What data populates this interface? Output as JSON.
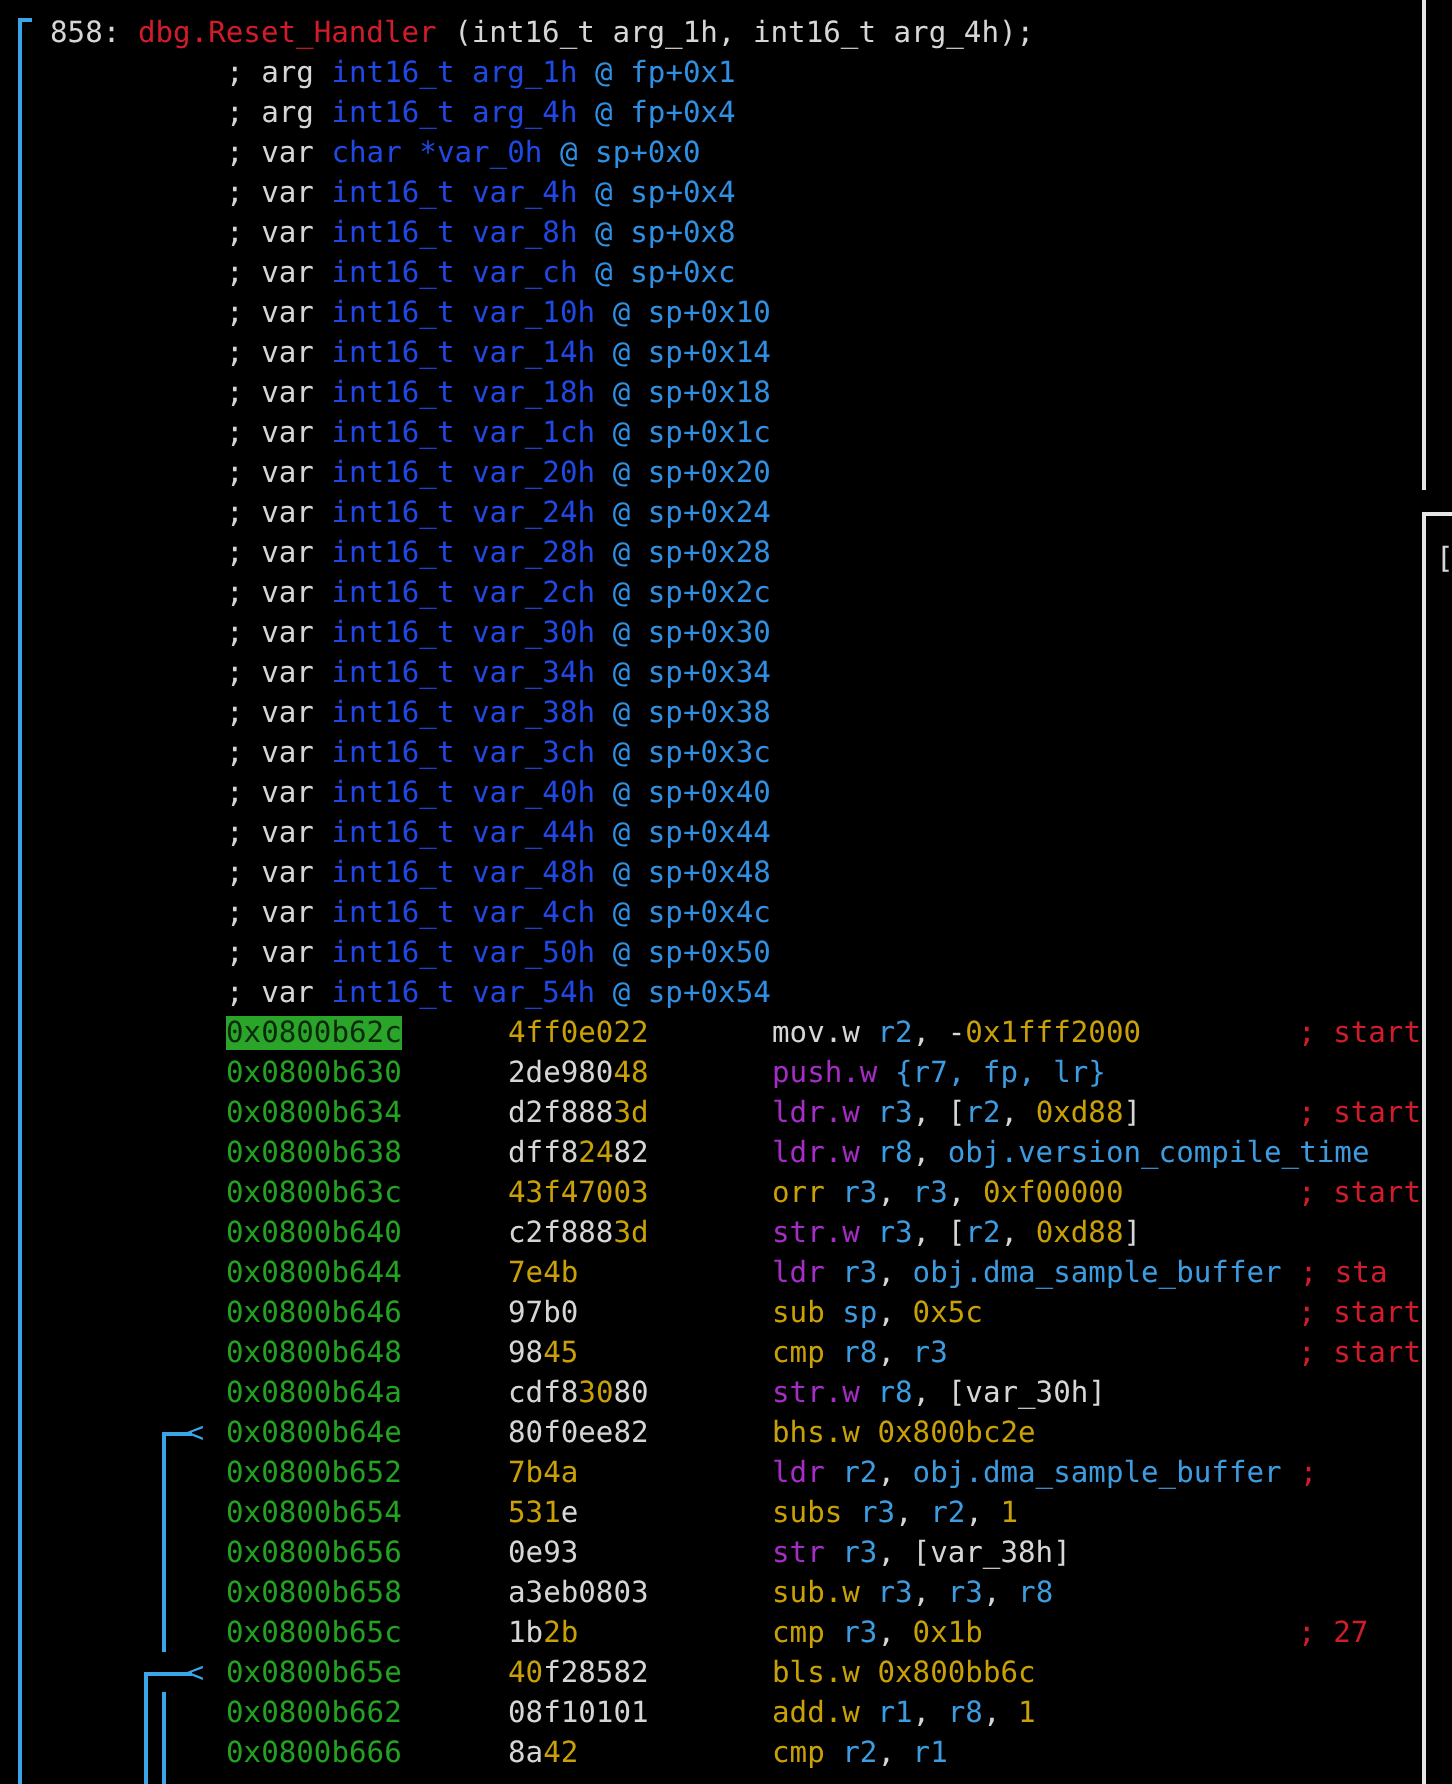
{
  "function": {
    "number": "858:",
    "name": "dbg.Reset_Handler",
    "signature": " (int16_t arg_1h, int16_t arg_4h);"
  },
  "variables": [
    {
      "marker": "; arg",
      "declaration": "int16_t arg_1h",
      "location": "@ fp+0x1"
    },
    {
      "marker": "; arg",
      "declaration": "int16_t arg_4h",
      "location": "@ fp+0x4"
    },
    {
      "marker": "; var",
      "declaration": "char *var_0h",
      "location": "@ sp+0x0"
    },
    {
      "marker": "; var",
      "declaration": "int16_t var_4h",
      "location": "@ sp+0x4"
    },
    {
      "marker": "; var",
      "declaration": "int16_t var_8h",
      "location": "@ sp+0x8"
    },
    {
      "marker": "; var",
      "declaration": "int16_t var_ch",
      "location": "@ sp+0xc"
    },
    {
      "marker": "; var",
      "declaration": "int16_t var_10h",
      "location": "@ sp+0x10"
    },
    {
      "marker": "; var",
      "declaration": "int16_t var_14h",
      "location": "@ sp+0x14"
    },
    {
      "marker": "; var",
      "declaration": "int16_t var_18h",
      "location": "@ sp+0x18"
    },
    {
      "marker": "; var",
      "declaration": "int16_t var_1ch",
      "location": "@ sp+0x1c"
    },
    {
      "marker": "; var",
      "declaration": "int16_t var_20h",
      "location": "@ sp+0x20"
    },
    {
      "marker": "; var",
      "declaration": "int16_t var_24h",
      "location": "@ sp+0x24"
    },
    {
      "marker": "; var",
      "declaration": "int16_t var_28h",
      "location": "@ sp+0x28"
    },
    {
      "marker": "; var",
      "declaration": "int16_t var_2ch",
      "location": "@ sp+0x2c"
    },
    {
      "marker": "; var",
      "declaration": "int16_t var_30h",
      "location": "@ sp+0x30"
    },
    {
      "marker": "; var",
      "declaration": "int16_t var_34h",
      "location": "@ sp+0x34"
    },
    {
      "marker": "; var",
      "declaration": "int16_t var_38h",
      "location": "@ sp+0x38"
    },
    {
      "marker": "; var",
      "declaration": "int16_t var_3ch",
      "location": "@ sp+0x3c"
    },
    {
      "marker": "; var",
      "declaration": "int16_t var_40h",
      "location": "@ sp+0x40"
    },
    {
      "marker": "; var",
      "declaration": "int16_t var_44h",
      "location": "@ sp+0x44"
    },
    {
      "marker": "; var",
      "declaration": "int16_t var_48h",
      "location": "@ sp+0x48"
    },
    {
      "marker": "; var",
      "declaration": "int16_t var_4ch",
      "location": "@ sp+0x4c"
    },
    {
      "marker": "; var",
      "declaration": "int16_t var_50h",
      "location": "@ sp+0x50"
    },
    {
      "marker": "; var",
      "declaration": "int16_t var_54h",
      "location": "@ sp+0x54"
    }
  ],
  "instructions": [
    {
      "address": "0x0800b62c",
      "selected": true,
      "bytes": [
        {
          "text": "4ff0e022",
          "kind": "highlight"
        }
      ],
      "code": [
        {
          "text": "mov.w",
          "kind": "plain"
        },
        {
          "text": " r2",
          "kind": "register"
        },
        {
          "text": ", -",
          "kind": "plain"
        },
        {
          "text": "0x1fff2000",
          "kind": "number"
        }
      ],
      "comment": "; start"
    },
    {
      "address": "0x0800b630",
      "selected": false,
      "bytes": [
        {
          "text": "2de980",
          "kind": "plain"
        },
        {
          "text": "48",
          "kind": "highlight"
        }
      ],
      "code": [
        {
          "text": "push.w",
          "kind": "mem_op"
        },
        {
          "text": " {r7, fp, lr}",
          "kind": "register"
        }
      ]
    },
    {
      "address": "0x0800b634",
      "selected": false,
      "bytes": [
        {
          "text": "d2f888",
          "kind": "plain"
        },
        {
          "text": "3d",
          "kind": "highlight"
        }
      ],
      "code": [
        {
          "text": "ldr.w",
          "kind": "mem_op"
        },
        {
          "text": " r3",
          "kind": "register"
        },
        {
          "text": ", [",
          "kind": "plain"
        },
        {
          "text": "r2",
          "kind": "register"
        },
        {
          "text": ", ",
          "kind": "plain"
        },
        {
          "text": "0xd88",
          "kind": "number"
        },
        {
          "text": "]",
          "kind": "plain"
        }
      ],
      "comment": "; start"
    },
    {
      "address": "0x0800b638",
      "selected": false,
      "bytes": [
        {
          "text": "dff8",
          "kind": "plain"
        },
        {
          "text": "24",
          "kind": "highlight"
        },
        {
          "text": "82",
          "kind": "plain"
        }
      ],
      "code": [
        {
          "text": "ldr.w",
          "kind": "mem_op"
        },
        {
          "text": " r8",
          "kind": "register"
        },
        {
          "text": ", ",
          "kind": "plain"
        },
        {
          "text": "obj.version_compile_time",
          "kind": "symbol"
        }
      ]
    },
    {
      "address": "0x0800b63c",
      "selected": false,
      "bytes": [
        {
          "text": "43f47003",
          "kind": "highlight"
        }
      ],
      "code": [
        {
          "text": "orr",
          "kind": "op"
        },
        {
          "text": " r3",
          "kind": "register"
        },
        {
          "text": ", ",
          "kind": "plain"
        },
        {
          "text": "r3",
          "kind": "register"
        },
        {
          "text": ", ",
          "kind": "plain"
        },
        {
          "text": "0xf00000",
          "kind": "number"
        }
      ],
      "comment": "; start"
    },
    {
      "address": "0x0800b640",
      "selected": false,
      "bytes": [
        {
          "text": "c2f888",
          "kind": "plain"
        },
        {
          "text": "3d",
          "kind": "highlight"
        }
      ],
      "code": [
        {
          "text": "str.w",
          "kind": "mem_op"
        },
        {
          "text": " r3",
          "kind": "register"
        },
        {
          "text": ", [",
          "kind": "plain"
        },
        {
          "text": "r2",
          "kind": "register"
        },
        {
          "text": ", ",
          "kind": "plain"
        },
        {
          "text": "0xd88",
          "kind": "number"
        },
        {
          "text": "]",
          "kind": "plain"
        }
      ]
    },
    {
      "address": "0x0800b644",
      "selected": false,
      "bytes": [
        {
          "text": "7e4b",
          "kind": "highlight"
        }
      ],
      "code": [
        {
          "text": "ldr",
          "kind": "mem_op"
        },
        {
          "text": " r3",
          "kind": "register"
        },
        {
          "text": ", ",
          "kind": "plain"
        },
        {
          "text": "obj.dma_sample_buffer",
          "kind": "symbol"
        }
      ],
      "comment": "; sta"
    },
    {
      "address": "0x0800b646",
      "selected": false,
      "bytes": [
        {
          "text": "97b0",
          "kind": "plain"
        }
      ],
      "code": [
        {
          "text": "sub",
          "kind": "op"
        },
        {
          "text": " sp",
          "kind": "register"
        },
        {
          "text": ", ",
          "kind": "plain"
        },
        {
          "text": "0x5c",
          "kind": "number"
        }
      ],
      "comment": "; start"
    },
    {
      "address": "0x0800b648",
      "selected": false,
      "bytes": [
        {
          "text": "98",
          "kind": "plain"
        },
        {
          "text": "45",
          "kind": "highlight"
        }
      ],
      "code": [
        {
          "text": "cmp",
          "kind": "op"
        },
        {
          "text": " r8",
          "kind": "register"
        },
        {
          "text": ", ",
          "kind": "plain"
        },
        {
          "text": "r3",
          "kind": "register"
        }
      ],
      "comment": "; start"
    },
    {
      "address": "0x0800b64a",
      "selected": false,
      "bytes": [
        {
          "text": "cdf8",
          "kind": "plain"
        },
        {
          "text": "30",
          "kind": "highlight"
        },
        {
          "text": "80",
          "kind": "plain"
        }
      ],
      "code": [
        {
          "text": "str.w",
          "kind": "mem_op"
        },
        {
          "text": " r8",
          "kind": "register"
        },
        {
          "text": ", [var_30h]",
          "kind": "plain"
        }
      ]
    },
    {
      "address": "0x0800b64e",
      "selected": false,
      "jump_marker": "<",
      "bytes": [
        {
          "text": "80f0ee82",
          "kind": "plain"
        }
      ],
      "code": [
        {
          "text": "bhs.w",
          "kind": "op"
        },
        {
          "text": " 0x800bc2e",
          "kind": "number"
        }
      ]
    },
    {
      "address": "0x0800b652",
      "selected": false,
      "bytes": [
        {
          "text": "7b4a",
          "kind": "highlight"
        }
      ],
      "code": [
        {
          "text": "ldr",
          "kind": "mem_op"
        },
        {
          "text": " r2",
          "kind": "register"
        },
        {
          "text": ", ",
          "kind": "plain"
        },
        {
          "text": "obj.dma_sample_buffer",
          "kind": "symbol"
        }
      ],
      "comment": ";"
    },
    {
      "address": "0x0800b654",
      "selected": false,
      "bytes": [
        {
          "text": "531",
          "kind": "highlight"
        },
        {
          "text": "e",
          "kind": "plain"
        }
      ],
      "code": [
        {
          "text": "subs",
          "kind": "op"
        },
        {
          "text": " r3",
          "kind": "register"
        },
        {
          "text": ", ",
          "kind": "plain"
        },
        {
          "text": "r2",
          "kind": "register"
        },
        {
          "text": ", ",
          "kind": "plain"
        },
        {
          "text": "1",
          "kind": "number"
        }
      ]
    },
    {
      "address": "0x0800b656",
      "selected": false,
      "bytes": [
        {
          "text": "0e93",
          "kind": "plain"
        }
      ],
      "code": [
        {
          "text": "str",
          "kind": "mem_op"
        },
        {
          "text": " r3",
          "kind": "register"
        },
        {
          "text": ", [var_38h]",
          "kind": "plain"
        }
      ]
    },
    {
      "address": "0x0800b658",
      "selected": false,
      "bytes": [
        {
          "text": "a3eb0803",
          "kind": "plain"
        }
      ],
      "code": [
        {
          "text": "sub.w",
          "kind": "op"
        },
        {
          "text": " r3",
          "kind": "register"
        },
        {
          "text": ", ",
          "kind": "plain"
        },
        {
          "text": "r3",
          "kind": "register"
        },
        {
          "text": ", ",
          "kind": "plain"
        },
        {
          "text": "r8",
          "kind": "register"
        }
      ]
    },
    {
      "address": "0x0800b65c",
      "selected": false,
      "bytes": [
        {
          "text": "1b",
          "kind": "plain"
        },
        {
          "text": "2b",
          "kind": "highlight"
        }
      ],
      "code": [
        {
          "text": "cmp",
          "kind": "op"
        },
        {
          "text": " r3",
          "kind": "register"
        },
        {
          "text": ", ",
          "kind": "plain"
        },
        {
          "text": "0x1b",
          "kind": "number"
        }
      ],
      "comment": "; 27"
    },
    {
      "address": "0x0800b65e",
      "selected": false,
      "jump_marker": "<",
      "bytes": [
        {
          "text": "40",
          "kind": "highlight"
        },
        {
          "text": "f28582",
          "kind": "plain"
        }
      ],
      "code": [
        {
          "text": "bls.w",
          "kind": "op"
        },
        {
          "text": " 0x800bb6c",
          "kind": "number"
        }
      ]
    },
    {
      "address": "0x0800b662",
      "selected": false,
      "bytes": [
        {
          "text": "08f10101",
          "kind": "plain"
        }
      ],
      "code": [
        {
          "text": "add.w",
          "kind": "op"
        },
        {
          "text": " r1",
          "kind": "register"
        },
        {
          "text": ", ",
          "kind": "plain"
        },
        {
          "text": "r8",
          "kind": "register"
        },
        {
          "text": ", ",
          "kind": "plain"
        },
        {
          "text": "1",
          "kind": "number"
        }
      ]
    },
    {
      "address": "0x0800b666",
      "selected": false,
      "bytes": [
        {
          "text": "8a",
          "kind": "plain"
        },
        {
          "text": "42",
          "kind": "highlight"
        }
      ],
      "code": [
        {
          "text": "cmp",
          "kind": "op"
        },
        {
          "text": " r2",
          "kind": "register"
        },
        {
          "text": ", ",
          "kind": "plain"
        },
        {
          "text": "r1",
          "kind": "register"
        }
      ]
    }
  ],
  "side_panel": {
    "text": "["
  }
}
